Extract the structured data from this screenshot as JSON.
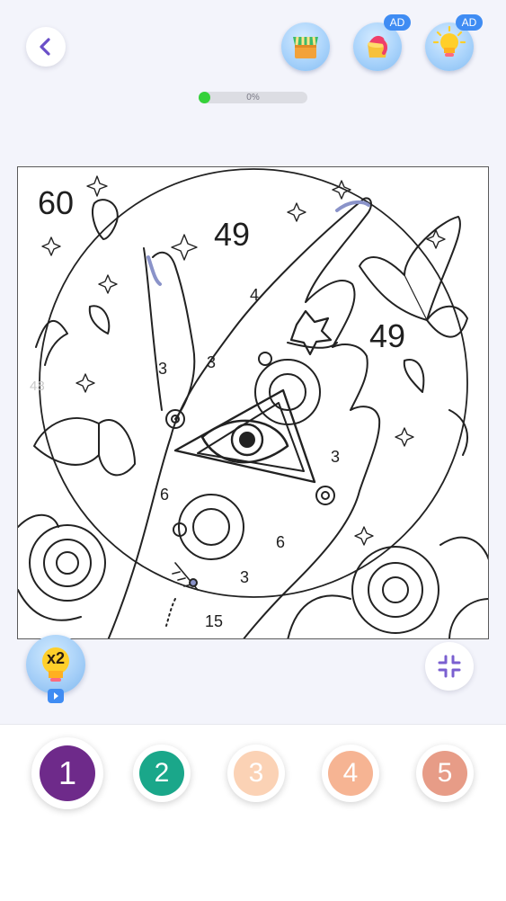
{
  "toolbar": {
    "back_icon": "chevron-left-icon",
    "tools": [
      {
        "name": "shop",
        "icon": "shop-icon",
        "ad": false
      },
      {
        "name": "paint-bucket",
        "icon": "paint-bucket-icon",
        "ad": true,
        "ad_label": "AD"
      },
      {
        "name": "hint",
        "icon": "lightbulb-icon",
        "ad": true,
        "ad_label": "AD"
      }
    ]
  },
  "progress": {
    "value": 0,
    "label": "0%",
    "color": "#35d13a"
  },
  "canvas": {
    "numbers": [
      "60",
      "49",
      "49",
      "48",
      "4",
      "3",
      "3",
      "3",
      "6",
      "6",
      "3",
      "15"
    ]
  },
  "hint_x2": {
    "label": "x2",
    "icon": "lightbulb-icon",
    "badge_icon": "video-play-icon"
  },
  "collapse": {
    "icon": "collapse-icon"
  },
  "palette": {
    "colors": [
      {
        "label": "1",
        "color": "#6e2a8a",
        "selected": true
      },
      {
        "label": "2",
        "color": "#1aa78a",
        "selected": false
      },
      {
        "label": "3",
        "color": "#fbd2b5",
        "selected": false
      },
      {
        "label": "4",
        "color": "#f6b493",
        "selected": false
      },
      {
        "label": "5",
        "color": "#e79c87",
        "selected": false
      }
    ]
  }
}
